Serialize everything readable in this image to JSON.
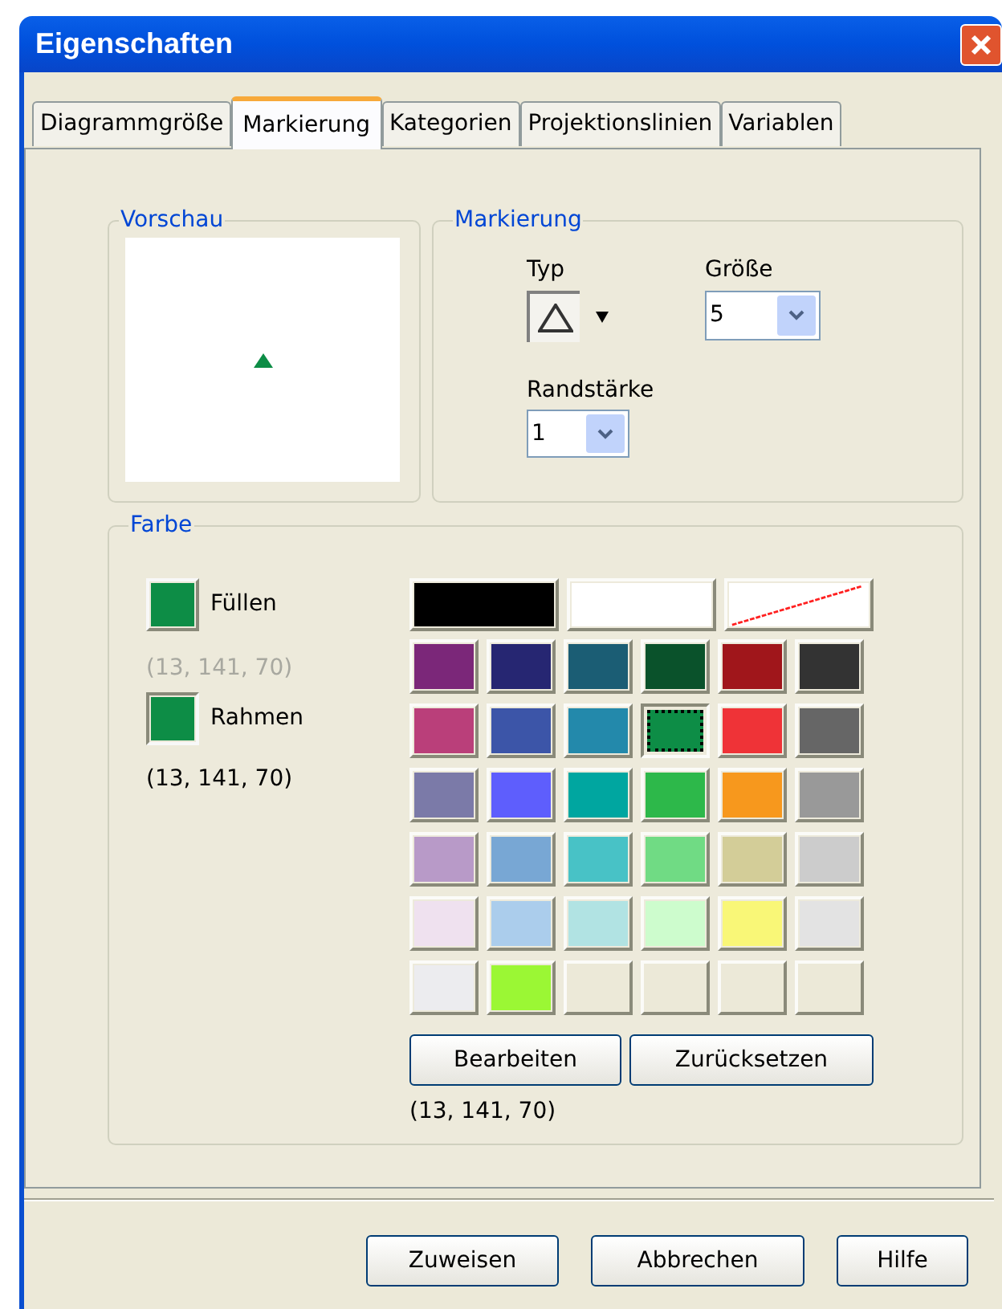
{
  "window": {
    "title": "Eigenschaften"
  },
  "tabs": [
    {
      "label": "Diagrammgröße",
      "selected": false
    },
    {
      "label": "Markierung",
      "selected": true
    },
    {
      "label": "Kategorien",
      "selected": false
    },
    {
      "label": "Projektionslinien",
      "selected": false
    },
    {
      "label": "Variablen",
      "selected": false
    }
  ],
  "preview": {
    "title": "Vorschau"
  },
  "marker": {
    "title": "Markierung",
    "type_label": "Typ",
    "size_label": "Größe",
    "size_value": "5",
    "border_label": "Randstärke",
    "border_value": "1"
  },
  "color": {
    "title": "Farbe",
    "fill": {
      "label": "Füllen",
      "value": "(13, 141, 70)",
      "disabled": true
    },
    "border": {
      "label": "Rahmen",
      "value": "(13, 141, 70)",
      "disabled": false
    },
    "special": [
      {
        "kind": "black",
        "selected": false
      },
      {
        "kind": "white",
        "selected": false
      },
      {
        "kind": "none",
        "selected": false
      }
    ],
    "palette": [
      {
        "kind": "swatch",
        "color": "#7b2779",
        "selected": false
      },
      {
        "kind": "swatch",
        "color": "#262672",
        "selected": false
      },
      {
        "kind": "swatch",
        "color": "#1b5d74",
        "selected": false
      },
      {
        "kind": "swatch",
        "color": "#0a522b",
        "selected": false
      },
      {
        "kind": "swatch",
        "color": "#a0161b",
        "selected": false
      },
      {
        "kind": "swatch",
        "color": "#333333",
        "selected": false
      },
      {
        "kind": "swatch",
        "color": "#ba3f7a",
        "selected": false
      },
      {
        "kind": "swatch",
        "color": "#3c55a8",
        "selected": false
      },
      {
        "kind": "swatch",
        "color": "#2389ab",
        "selected": false
      },
      {
        "kind": "swatch",
        "color": "#0d8d46",
        "selected": true
      },
      {
        "kind": "swatch",
        "color": "#ef3337",
        "selected": false
      },
      {
        "kind": "swatch",
        "color": "#666666",
        "selected": false
      },
      {
        "kind": "swatch",
        "color": "#7b7aa8",
        "selected": false
      },
      {
        "kind": "swatch",
        "color": "#5e5efd",
        "selected": false
      },
      {
        "kind": "swatch",
        "color": "#00a6a0",
        "selected": false
      },
      {
        "kind": "swatch",
        "color": "#2db84a",
        "selected": false
      },
      {
        "kind": "swatch",
        "color": "#f7981d",
        "selected": false
      },
      {
        "kind": "swatch",
        "color": "#999999",
        "selected": false
      },
      {
        "kind": "swatch",
        "color": "#b89ac8",
        "selected": false
      },
      {
        "kind": "swatch",
        "color": "#78a7d4",
        "selected": false
      },
      {
        "kind": "swatch",
        "color": "#48c2c6",
        "selected": false
      },
      {
        "kind": "swatch",
        "color": "#70db84",
        "selected": false
      },
      {
        "kind": "swatch",
        "color": "#d3cd98",
        "selected": false
      },
      {
        "kind": "swatch",
        "color": "#cccccc",
        "selected": false
      },
      {
        "kind": "swatch",
        "color": "#efe1ef",
        "selected": false
      },
      {
        "kind": "swatch",
        "color": "#abcdec",
        "selected": false
      },
      {
        "kind": "swatch",
        "color": "#b1e3e3",
        "selected": false
      },
      {
        "kind": "swatch",
        "color": "#cdfccd",
        "selected": false
      },
      {
        "kind": "swatch",
        "color": "#f9f777",
        "selected": false
      },
      {
        "kind": "swatch",
        "color": "#e3e3e3",
        "selected": false
      },
      {
        "kind": "swatch",
        "color": "#ececef",
        "selected": false
      },
      {
        "kind": "swatch",
        "color": "#9bf734",
        "selected": false
      },
      {
        "kind": "empty",
        "selected": false
      },
      {
        "kind": "empty",
        "selected": false
      },
      {
        "kind": "empty",
        "selected": false
      },
      {
        "kind": "empty",
        "selected": false
      }
    ],
    "buttons": [
      "Bearbeiten",
      "Zurücksetzen"
    ],
    "value": "(13, 141, 70)"
  },
  "footer_buttons": [
    "Zuweisen",
    "Abbrechen",
    "Hilfe"
  ]
}
